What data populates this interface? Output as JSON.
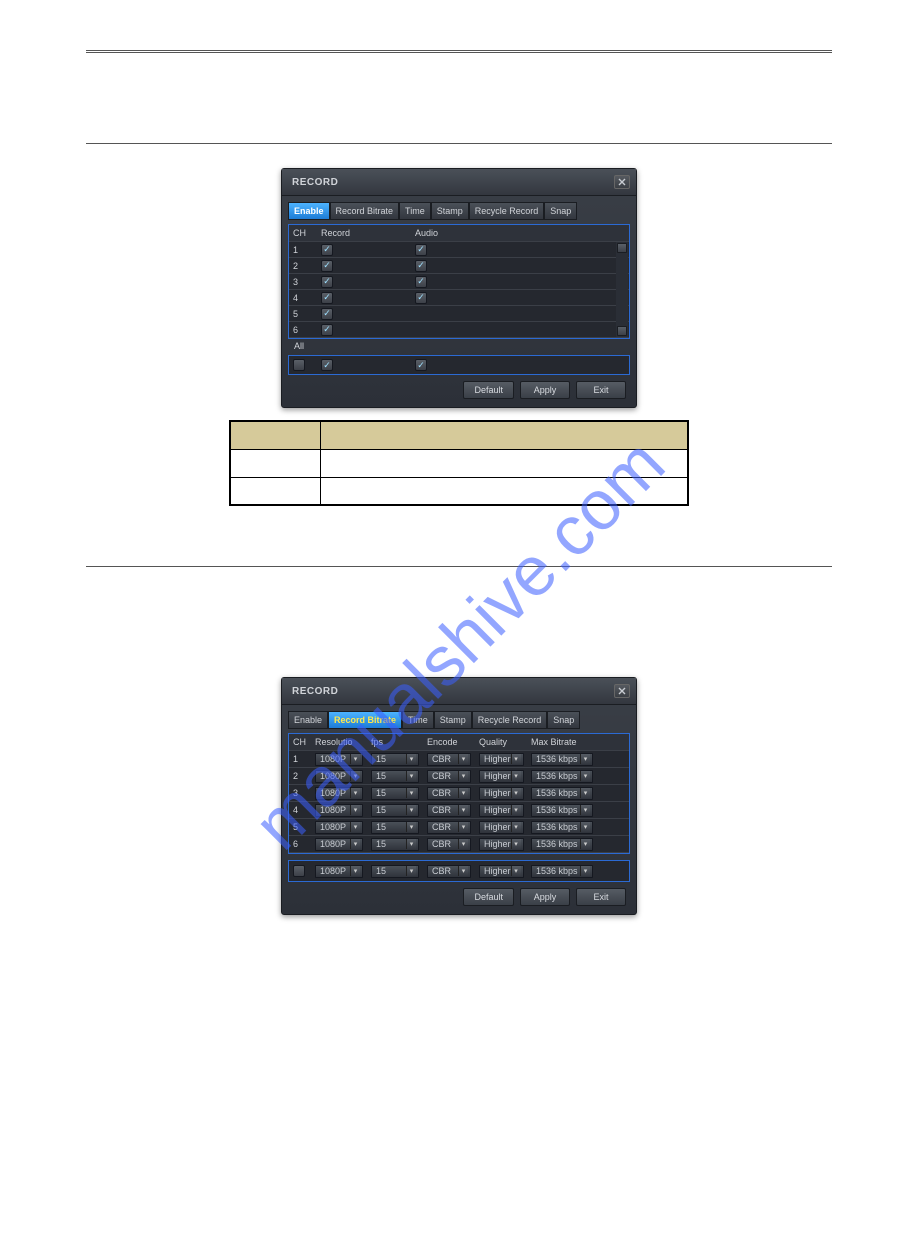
{
  "watermark_text": "manualshive.com",
  "dialog1": {
    "title": "RECORD",
    "tabs": [
      "Enable",
      "Record Bitrate",
      "Time",
      "Stamp",
      "Recycle Record",
      "Snap"
    ],
    "active_tab": 0,
    "cols": {
      "ch": "CH",
      "record": "Record",
      "audio": "Audio"
    },
    "rows": [
      {
        "ch": "1",
        "record": true,
        "audio": true
      },
      {
        "ch": "2",
        "record": true,
        "audio": true
      },
      {
        "ch": "3",
        "record": true,
        "audio": true
      },
      {
        "ch": "4",
        "record": true,
        "audio": true
      },
      {
        "ch": "5",
        "record": true,
        "audio": false
      },
      {
        "ch": "6",
        "record": true,
        "audio": false
      }
    ],
    "all_label": "All",
    "all": {
      "master": false,
      "record": true,
      "audio": true
    },
    "buttons": {
      "default_": "Default",
      "apply": "Apply",
      "exit": "Exit"
    }
  },
  "params_table": {
    "headers": [
      "",
      ""
    ],
    "rows": [
      [
        "",
        ""
      ],
      [
        "",
        ""
      ]
    ]
  },
  "dialog2": {
    "title": "RECORD",
    "tabs": [
      "Enable",
      "Record Bitrate",
      "Time",
      "Stamp",
      "Recycle Record",
      "Snap"
    ],
    "active_tab": 1,
    "cols": {
      "ch": "CH",
      "res": "Resolutio",
      "fps": "fps",
      "enc": "Encode",
      "qual": "Quality",
      "max": "Max Bitrate"
    },
    "rows": [
      {
        "ch": "1",
        "res": "1080P",
        "fps": "15",
        "enc": "CBR",
        "qual": "Higher",
        "max": "1536 kbps"
      },
      {
        "ch": "2",
        "res": "1080P",
        "fps": "15",
        "enc": "CBR",
        "qual": "Higher",
        "max": "1536 kbps"
      },
      {
        "ch": "3",
        "res": "1080P",
        "fps": "15",
        "enc": "CBR",
        "qual": "Higher",
        "max": "1536 kbps"
      },
      {
        "ch": "4",
        "res": "1080P",
        "fps": "15",
        "enc": "CBR",
        "qual": "Higher",
        "max": "1536 kbps"
      },
      {
        "ch": "5",
        "res": "1080P",
        "fps": "15",
        "enc": "CBR",
        "qual": "Higher",
        "max": "1536 kbps"
      },
      {
        "ch": "6",
        "res": "1080P",
        "fps": "15",
        "enc": "CBR",
        "qual": "Higher",
        "max": "1536 kbps"
      }
    ],
    "all_row": {
      "res": "1080P",
      "fps": "15",
      "enc": "CBR",
      "qual": "Higher",
      "max": "1536 kbps"
    },
    "buttons": {
      "default_": "Default",
      "apply": "Apply",
      "exit": "Exit"
    }
  }
}
